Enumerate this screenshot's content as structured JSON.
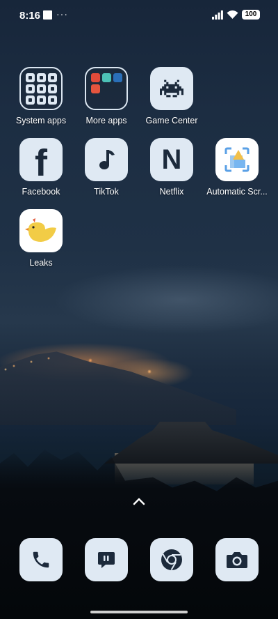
{
  "status_bar": {
    "time": "8:16",
    "notification_dots": "···",
    "battery": "100"
  },
  "home_screen": {
    "apps": [
      {
        "label": "System apps",
        "icon": "system-apps-folder-icon"
      },
      {
        "label": "More apps",
        "icon": "more-apps-folder-icon"
      },
      {
        "label": "Game Center",
        "icon": "space-invader-icon"
      },
      {
        "label": "Facebook",
        "icon": "facebook-icon"
      },
      {
        "label": "TikTok",
        "icon": "music-note-icon"
      },
      {
        "label": "Netflix",
        "icon": "netflix-n-icon"
      },
      {
        "label": "Automatic Scr...",
        "icon": "automatic-screenshot-icon"
      },
      {
        "label": "Leaks",
        "icon": "chick-icon"
      }
    ],
    "facebook_glyph": "f",
    "netflix_glyph": "N"
  },
  "dock": [
    {
      "name": "Phone",
      "icon": "phone-icon"
    },
    {
      "name": "Messages",
      "icon": "message-icon"
    },
    {
      "name": "Chrome",
      "icon": "chrome-icon"
    },
    {
      "name": "Camera",
      "icon": "camera-icon"
    }
  ],
  "colors": {
    "icon_bg": "#dfe9f3",
    "icon_glyph": "#1c2a3b"
  }
}
